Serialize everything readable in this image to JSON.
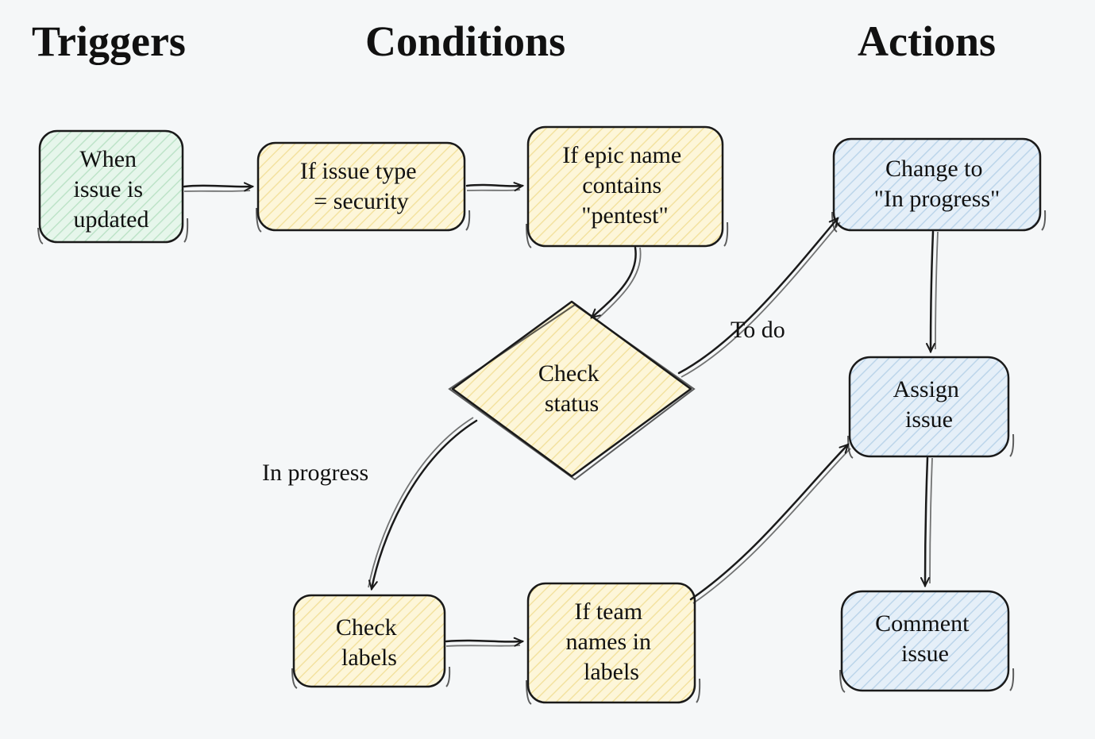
{
  "headings": {
    "triggers": "Triggers",
    "conditions": "Conditions",
    "actions": "Actions"
  },
  "nodes": {
    "trigger_updated": "When issue is updated",
    "cond_issue_type": "If issue type = security",
    "cond_epic_name": "If epic name contains \"pentest\"",
    "cond_check_status": "Check status",
    "cond_check_labels": "Check labels",
    "cond_team_labels": "If team names in labels",
    "action_change_progress": "Change to \"In progress\"",
    "action_assign": "Assign issue",
    "action_comment": "Comment issue"
  },
  "edges": {
    "to_do": "To do",
    "in_progress": "In progress"
  },
  "colors": {
    "trigger_fill": "#d9f2e1",
    "condition_fill": "#fbf0c8",
    "action_fill": "#d6e6f3",
    "stroke": "#1a1a1a",
    "bg": "#f5f7f8"
  }
}
